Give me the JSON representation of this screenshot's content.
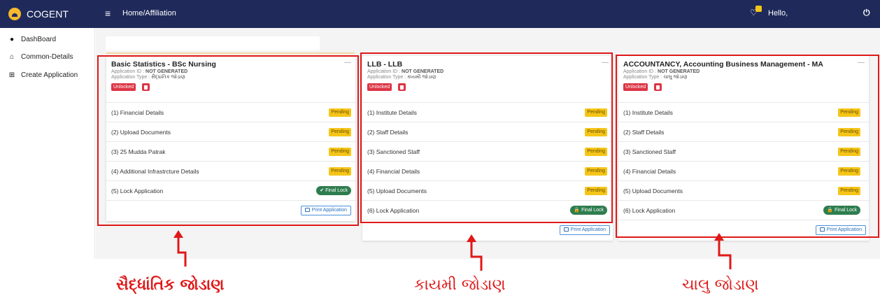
{
  "app": {
    "brand": "COGENT",
    "breadcrumb": "Home/Affiliation",
    "greeting": "Hello,"
  },
  "sidebar": {
    "items": [
      {
        "label": "DashBoard",
        "icon": "dashboard-icon"
      },
      {
        "label": "Common-Details",
        "icon": "home-icon"
      },
      {
        "label": "Create Application",
        "icon": "plus-square-icon"
      }
    ]
  },
  "cards": [
    {
      "title": "Basic Statistics - BSc Nursing",
      "app_id_label": "Application ID : ",
      "app_id_value": "NOT GENERATED",
      "app_type_label": "Application Type : ",
      "app_type_value": "સૈદ્ધાંતિક જોડાણ",
      "status": "Unlocked",
      "steps": [
        {
          "label": "(1) Financial Details",
          "status": "Pending"
        },
        {
          "label": "(2) Upload Documents",
          "status": "Pending"
        },
        {
          "label": "(3) 25 Mudda Patrak",
          "status": "Pending"
        },
        {
          "label": "(4) Additional Infrastrcture Details",
          "status": "Pending"
        },
        {
          "label": "(5) Lock Application",
          "status": "Final Lock"
        }
      ],
      "print": "Print Application"
    },
    {
      "title": "LLB - LLB",
      "app_id_label": "Application ID : ",
      "app_id_value": "NOT GENERATED",
      "app_type_label": "Application Type : ",
      "app_type_value": "કાયમી જોડાણ",
      "status": "Unlocked",
      "steps": [
        {
          "label": "(1) Institute Details",
          "status": "Pending"
        },
        {
          "label": "(2) Staff Details",
          "status": "Pending"
        },
        {
          "label": "(3) Sanctioned Staff",
          "status": "Pending"
        },
        {
          "label": "(4) Financial Details",
          "status": "Pending"
        },
        {
          "label": "(5) Upload Documents",
          "status": "Pending"
        },
        {
          "label": "(6) Lock Application",
          "status": "Final Lock"
        }
      ],
      "print": "Print Application"
    },
    {
      "title": "ACCOUNTANCY, Accounting Business Management - MA",
      "app_id_label": "Application ID : ",
      "app_id_value": "NOT GENERATED",
      "app_type_label": "Application Type : ",
      "app_type_value": "ચાલુ જોડાણ",
      "status": "Unlocked",
      "steps": [
        {
          "label": "(1) Institute Details",
          "status": "Pending"
        },
        {
          "label": "(2) Staff Details",
          "status": "Pending"
        },
        {
          "label": "(3) Sanctioned Staff",
          "status": "Pending"
        },
        {
          "label": "(4) Financial Details",
          "status": "Pending"
        },
        {
          "label": "(5) Upload Documents",
          "status": "Pending"
        },
        {
          "label": "(6) Lock Application",
          "status": "Final Lock"
        }
      ],
      "print": "Print Application"
    }
  ],
  "annotations": [
    {
      "label": "સૈદ્ધાંતિક  જોડાણ"
    },
    {
      "label": "કાયમી જોડાણ"
    },
    {
      "label": "ચાલુ જોડાણ"
    }
  ],
  "colors": {
    "topbar": "#1f2a5a",
    "highlight": "#e01818",
    "pending": "#f5c518",
    "final_lock": "#2e7d4f",
    "unlocked": "#dc3545"
  }
}
